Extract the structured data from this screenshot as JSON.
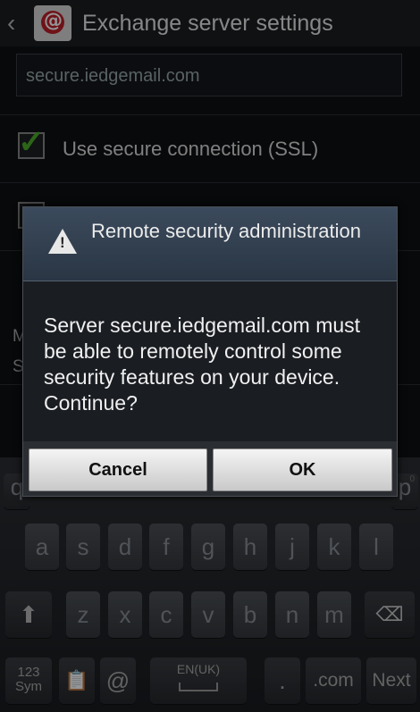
{
  "header": {
    "back_icon": "back-chevron-icon",
    "title": "Exchange server settings"
  },
  "settings": {
    "server_value": "secure.iedgemail.com",
    "ssl_label": "Use secure connection (SSL)",
    "ssl_checked": true,
    "partial_left_labels": [
      "M",
      "S"
    ]
  },
  "dialog": {
    "title": "Remote security administration",
    "message": "Server secure.iedgemail.com must be able to remotely control some security features on your device. Continue?",
    "cancel_label": "Cancel",
    "ok_label": "OK"
  },
  "keyboard": {
    "row_top_partial": [
      "q",
      "p"
    ],
    "row_top_p_sup": "0",
    "row2": [
      "a",
      "s",
      "d",
      "f",
      "g",
      "h",
      "j",
      "k",
      "l"
    ],
    "row3": [
      "z",
      "x",
      "c",
      "v",
      "b",
      "n",
      "m"
    ],
    "sym_top": "123",
    "sym_bottom": "Sym",
    "at": "@",
    "lang": "EN(UK)",
    "period": ".",
    "dotcom": ".com",
    "next": "Next"
  }
}
